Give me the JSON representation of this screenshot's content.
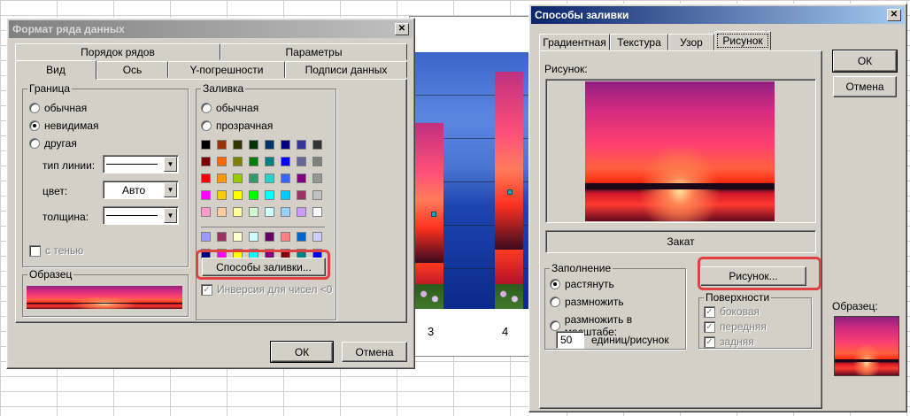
{
  "series_dialog": {
    "title": "Формат ряда данных",
    "tabs_top": [
      "Порядок рядов",
      "Параметры"
    ],
    "tabs_bottom": [
      "Вид",
      "Ось",
      "Y-погрешности",
      "Подписи данных"
    ],
    "border_group": {
      "title": "Граница",
      "options": [
        "обычная",
        "невидимая",
        "другая"
      ],
      "selected": "невидимая",
      "line_type_label": "тип линии:",
      "color_label": "цвет:",
      "color_value": "Авто",
      "thickness_label": "толщина:",
      "shadow_label": "с тенью"
    },
    "fill_group": {
      "title": "Заливка",
      "options": [
        "обычная",
        "прозрачная"
      ],
      "fill_effects_button": "Способы заливки...",
      "invert_label": "Инверсия для чисел <0"
    },
    "sample_label": "Образец",
    "ok_label": "ОК",
    "cancel_label": "Отмена"
  },
  "chart": {
    "category_labels": [
      "3",
      "4"
    ]
  },
  "fill_dialog": {
    "title": "Способы заливки",
    "tabs": [
      "Градиентная",
      "Текстура",
      "Узор",
      "Рисунок"
    ],
    "selected_tab": "Рисунок",
    "picture_label": "Рисунок:",
    "picture_name": "Закат",
    "fill_mode_group": {
      "title": "Заполнение",
      "options": [
        "растянуть",
        "размножить",
        "размножить в масштабе:"
      ],
      "selected": "растянуть",
      "scale_value": "50",
      "scale_unit": "единиц/рисунок"
    },
    "picture_button": "Рисунок...",
    "surfaces_group": {
      "title": "Поверхности",
      "options": [
        "боковая",
        "передняя",
        "задняя"
      ]
    },
    "ok_label": "ОК",
    "cancel_label": "Отмена",
    "sample_label": "Образец:"
  },
  "colors": {
    "highlight": "#e04040",
    "title_active": "#0a246a",
    "face": "#d4d0c8"
  }
}
